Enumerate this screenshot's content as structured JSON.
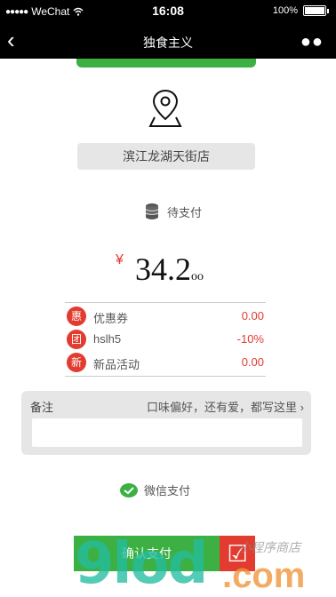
{
  "status_bar": {
    "carrier": "WeChat",
    "time": "16:08",
    "battery": "100%"
  },
  "nav": {
    "title": "独食主义",
    "back_icon": "chevron-left",
    "more_icon": "more-dots"
  },
  "store": {
    "name": "滨江龙湖天街店"
  },
  "payment_status": "待支付",
  "price": {
    "currency": "¥",
    "integer": "34.2",
    "decimal": "oo"
  },
  "discounts": [
    {
      "badge": "惠",
      "label": "优惠券",
      "value": "0.00"
    },
    {
      "badge": "团",
      "label": "hslh5",
      "value": "-10%"
    },
    {
      "badge": "新",
      "label": "新品活动",
      "value": "0.00"
    }
  ],
  "remark": {
    "label": "备注",
    "hint": "口味偏好，还有爱，都写这里 ›",
    "value": ""
  },
  "pay_method": {
    "label": "微信支付"
  },
  "confirm": {
    "label": "确认支付"
  },
  "watermark": {
    "brand": "9lod",
    "suffix": ".com",
    "cn": "小程序商店"
  },
  "colors": {
    "accent_green": "#3cb043",
    "accent_red": "#e23b2f",
    "nav_bg": "#000000"
  }
}
